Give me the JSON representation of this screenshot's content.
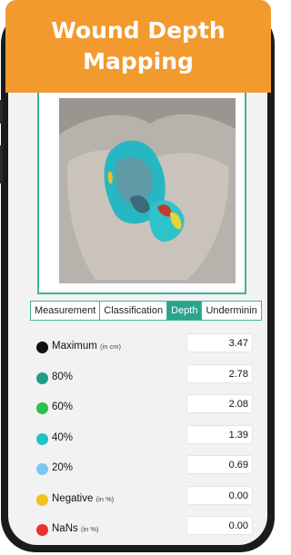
{
  "banner": {
    "line1": "Wound Depth",
    "line2": "Mapping"
  },
  "tabs": [
    {
      "label": "Measurement",
      "active": false
    },
    {
      "label": "Classification",
      "active": false
    },
    {
      "label": "Depth",
      "active": true
    },
    {
      "label": "Underminin",
      "active": false
    }
  ],
  "rows": [
    {
      "label": "Maximum",
      "unit": "(in cm)",
      "value": "3.47",
      "color": "#111111"
    },
    {
      "label": "80%",
      "unit": "",
      "value": "2.78",
      "color": "#1f9e87"
    },
    {
      "label": "60%",
      "unit": "",
      "value": "2.08",
      "color": "#2bc04a"
    },
    {
      "label": "40%",
      "unit": "",
      "value": "1.39",
      "color": "#20c1c7"
    },
    {
      "label": "20%",
      "unit": "",
      "value": "0.69",
      "color": "#7cc6f4"
    },
    {
      "label": "Negative",
      "unit": "(in %)",
      "value": "0.00",
      "color": "#f4c11c"
    },
    {
      "label": "NaNs",
      "unit": "(in %)",
      "value": "0.00",
      "color": "#e8322f"
    }
  ],
  "colors": {
    "accent": "#3fb39c",
    "banner": "#f29a2e",
    "active_tab": "#2aa58c"
  }
}
